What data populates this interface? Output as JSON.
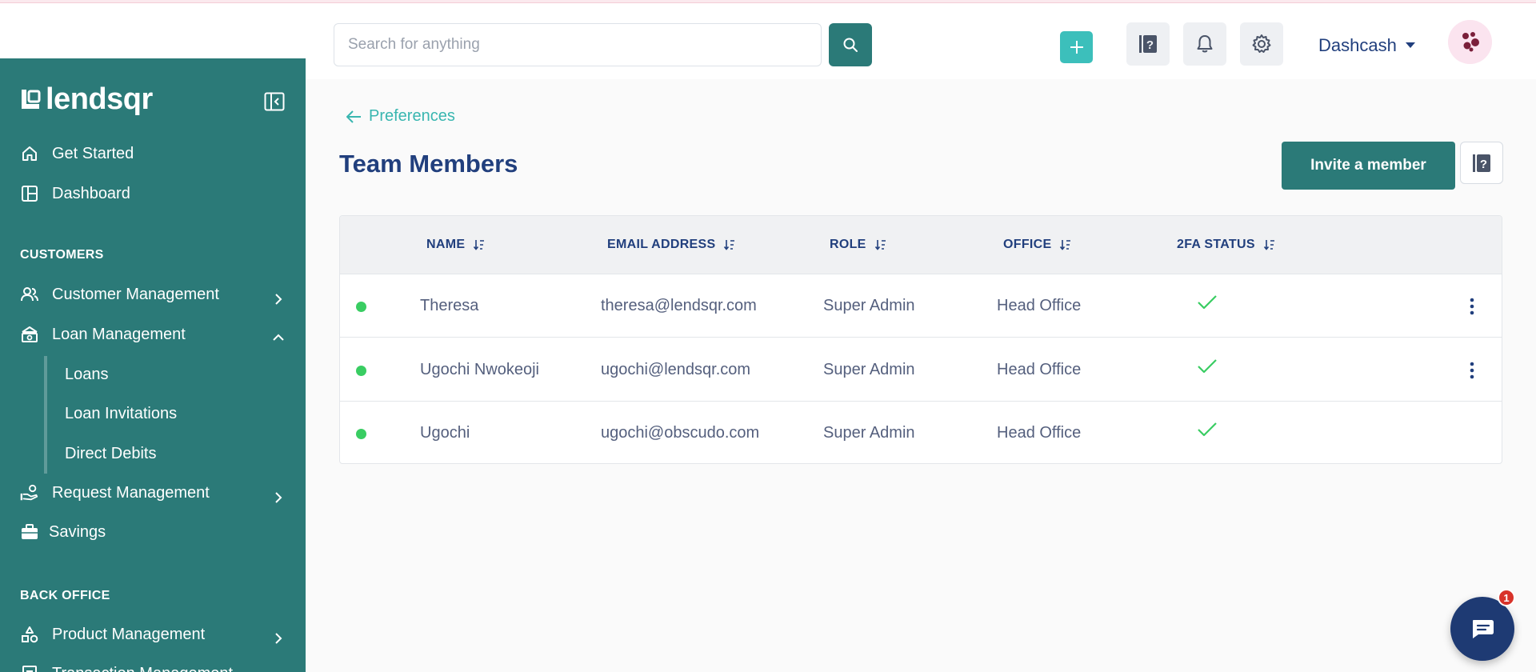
{
  "topbar": {
    "search": {
      "placeholder": "Search for anything",
      "value": ""
    },
    "user_name": "Dashcash"
  },
  "sidebar": {
    "logo_text": "lendsqr",
    "items": [
      {
        "label": "Get Started",
        "icon": "home-icon"
      },
      {
        "label": "Dashboard",
        "icon": "dashboard-icon"
      }
    ],
    "sections": [
      {
        "label": "CUSTOMERS",
        "items": [
          {
            "label": "Customer Management",
            "icon": "users-icon",
            "expanded": false
          },
          {
            "label": "Loan Management",
            "icon": "bank-icon",
            "expanded": true,
            "children": [
              {
                "label": "Loans"
              },
              {
                "label": "Loan Invitations"
              },
              {
                "label": "Direct Debits"
              }
            ]
          },
          {
            "label": "Request Management",
            "icon": "hand-coin-icon",
            "expanded": false
          },
          {
            "label": "Savings",
            "icon": "briefcase-icon"
          }
        ]
      },
      {
        "label": "BACK OFFICE",
        "items": [
          {
            "label": "Product Management",
            "icon": "shapes-icon",
            "expanded": false
          },
          {
            "label": "Transaction Management",
            "icon": "receipt-icon"
          }
        ]
      }
    ]
  },
  "main": {
    "back_link": "Preferences",
    "title": "Team Members",
    "invite_label": "Invite a member",
    "table": {
      "columns": [
        "NAME",
        "EMAIL ADDRESS",
        "ROLE",
        "OFFICE",
        "2FA STATUS"
      ],
      "rows": [
        {
          "name": "Theresa",
          "email": "theresa@lendsqr.com",
          "role": "Super Admin",
          "office": "Head Office",
          "twofa": true,
          "active": true,
          "has_menu": true
        },
        {
          "name": "Ugochi Nwokeoji",
          "email": "ugochi@lendsqr.com",
          "role": "Super Admin",
          "office": "Head Office",
          "twofa": true,
          "active": true,
          "has_menu": true
        },
        {
          "name": "Ugochi",
          "email": "ugochi@obscudo.com",
          "role": "Super Admin",
          "office": "Head Office",
          "twofa": true,
          "active": true,
          "has_menu": false
        }
      ]
    }
  },
  "chat": {
    "badge_count": "1"
  },
  "colors": {
    "brand": "#2b7a78",
    "accent": "#39b6b0",
    "text_primary": "#213f7d",
    "text_secondary": "#545f7d",
    "status_active": "#39cd62",
    "badge": "#d8332a"
  }
}
